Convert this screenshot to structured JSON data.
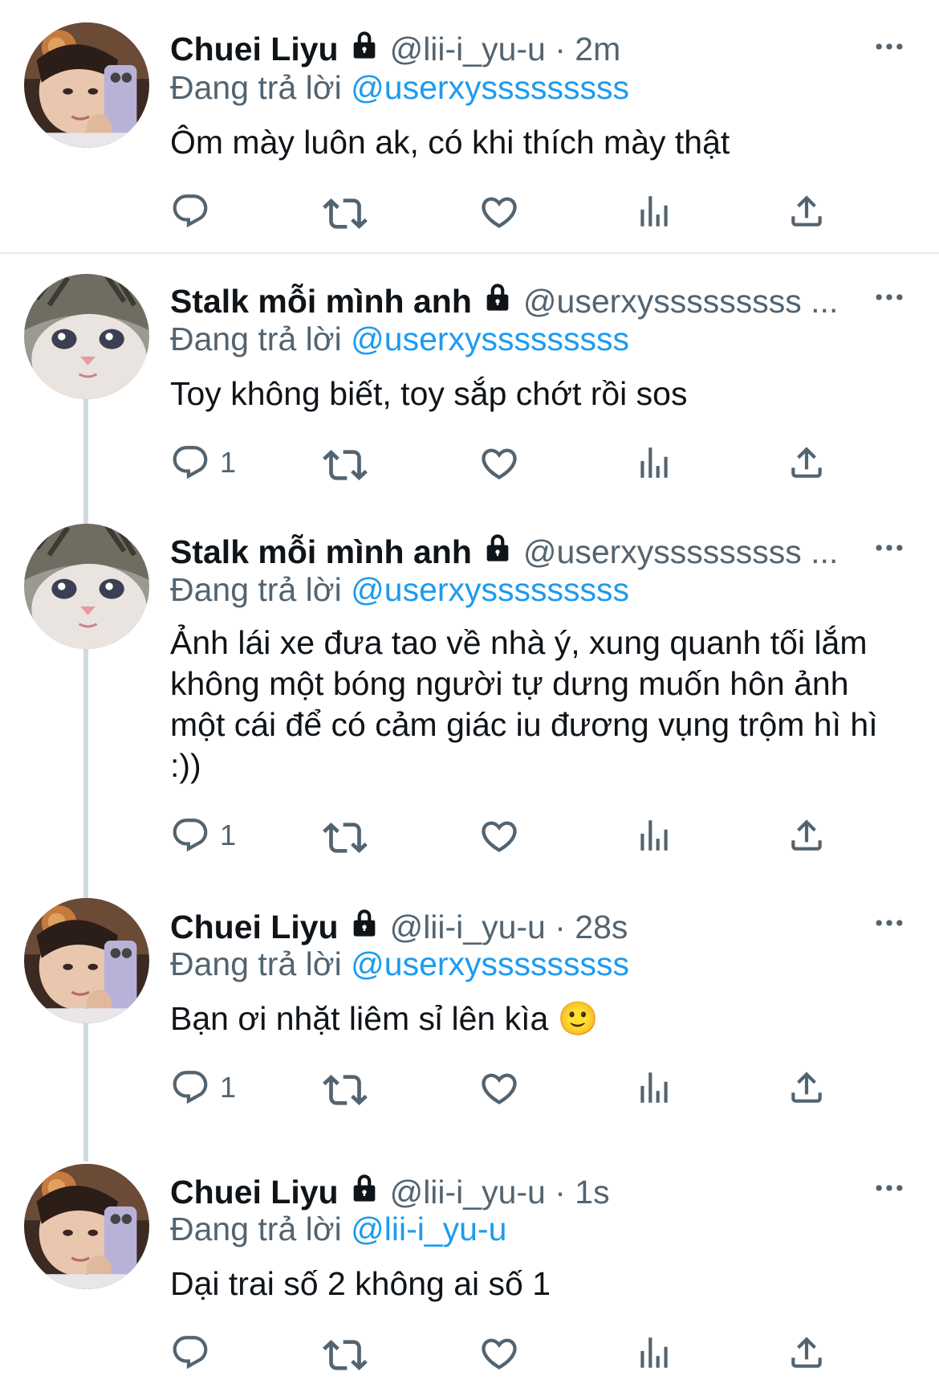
{
  "colors": {
    "accent": "#1d9bf0",
    "secondary": "#536471",
    "text": "#0f1419",
    "line": "#cfd9de"
  },
  "tweets": [
    {
      "name": "Chuei Liyu",
      "handle": "@lii-i_yu-u · 2m",
      "replying_prefix": "Đang trả lời",
      "replying_to": "@userxysssssssss",
      "text": "Ôm mày luôn ak, có khi thích mày thật",
      "reply_count": "",
      "avatar": "boy-avatar"
    },
    {
      "name": "Stalk mỗi mình anh",
      "handle": "@userxysssssssss ...",
      "replying_prefix": "Đang trả lời",
      "replying_to": "@userxysssssssss",
      "text": "Toy không biết, toy sắp chớt rồi sos",
      "reply_count": "1",
      "avatar": "cat-avatar"
    },
    {
      "name": "Stalk mỗi mình anh",
      "handle": "@userxysssssssss ...",
      "replying_prefix": "Đang trả lời",
      "replying_to": "@userxysssssssss",
      "text": "Ảnh lái xe đưa tao về nhà ý, xung quanh tối lắm không một bóng người tự dưng muốn hôn ảnh một cái để có cảm giác iu đương vụng trộm hì hì :))",
      "reply_count": "1",
      "avatar": "cat-avatar"
    },
    {
      "name": "Chuei Liyu",
      "handle": "@lii-i_yu-u · 28s",
      "replying_prefix": "Đang trả lời",
      "replying_to": "@userxysssssssss",
      "text": "Bạn ơi nhặt liêm sỉ lên kìa 🙂",
      "reply_count": "1",
      "avatar": "boy-avatar"
    },
    {
      "name": "Chuei Liyu",
      "handle": "@lii-i_yu-u · 1s",
      "replying_prefix": "Đang trả lời",
      "replying_to": "@lii-i_yu-u",
      "text": "Dại trai số 2 không ai số 1",
      "reply_count": "",
      "avatar": "boy-avatar"
    }
  ],
  "icons": {
    "reply": "reply-icon",
    "retweet": "retweet-icon",
    "like": "heart-icon",
    "views": "views-icon",
    "share": "share-icon",
    "more": "more-icon",
    "lock": "lock-icon"
  }
}
